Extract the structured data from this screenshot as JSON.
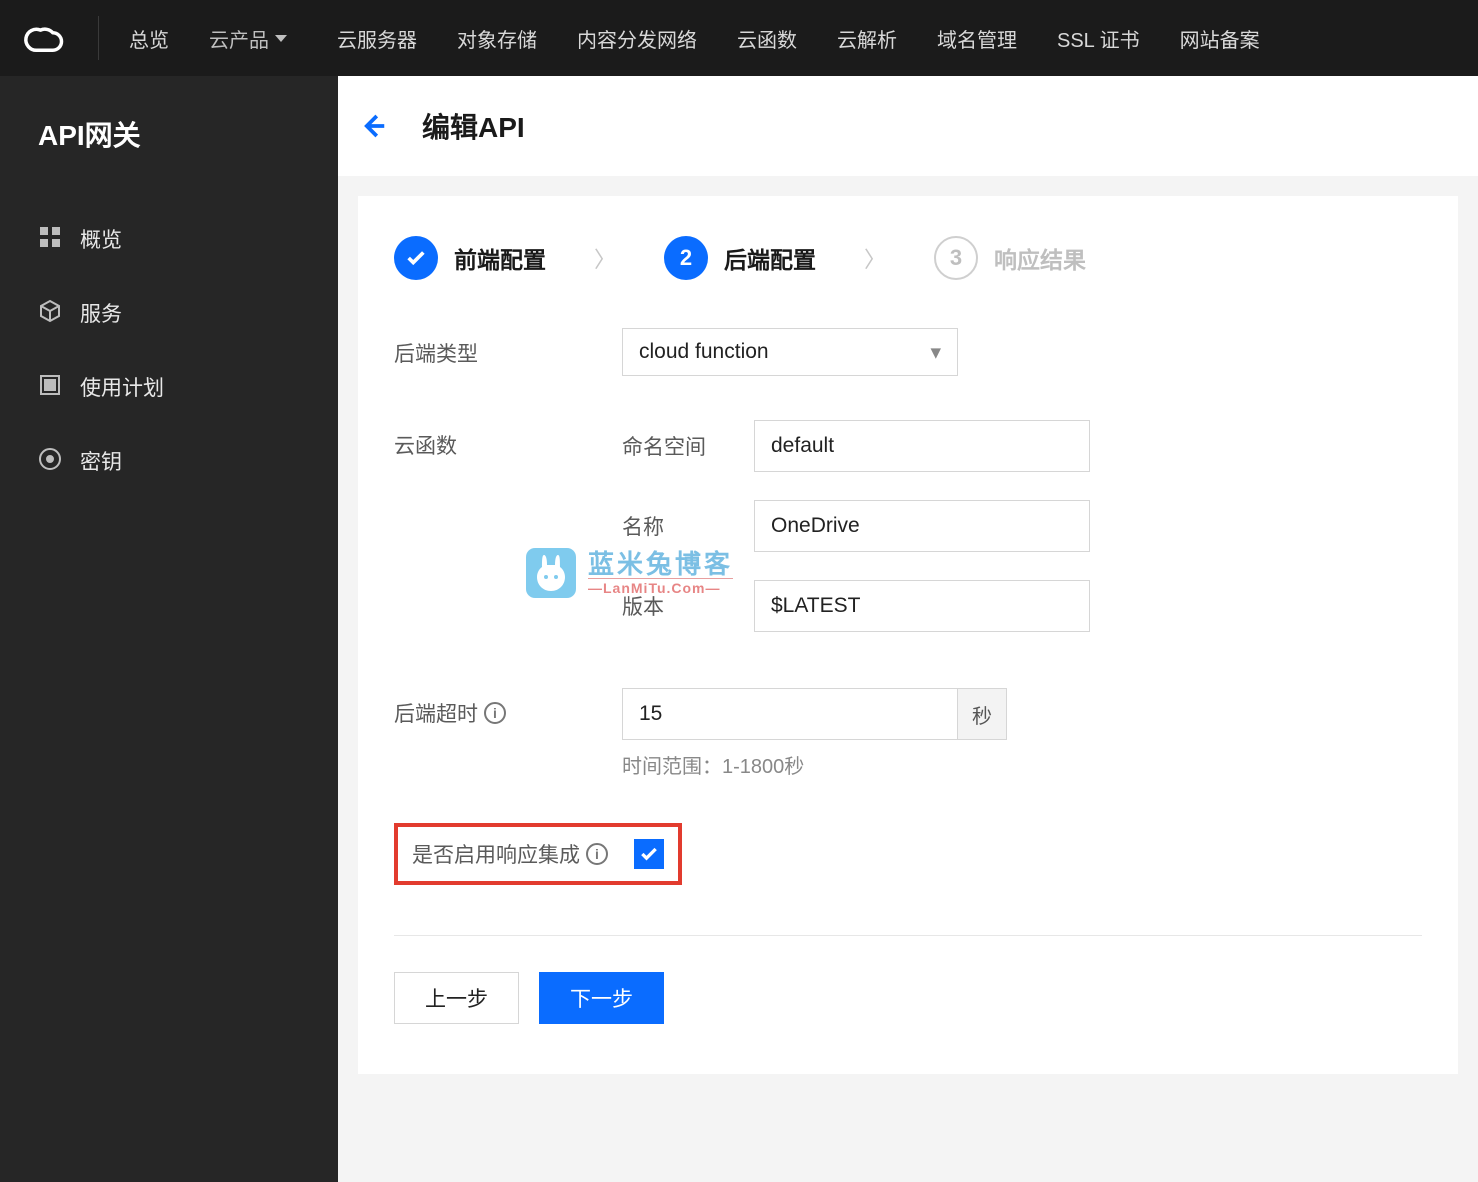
{
  "topnav": {
    "items": [
      "总览",
      "云产品",
      "云服务器",
      "对象存储",
      "内容分发网络",
      "云函数",
      "云解析",
      "域名管理",
      "SSL 证书",
      "网站备案"
    ]
  },
  "sidebar": {
    "title": "API网关",
    "items": [
      {
        "label": "概览"
      },
      {
        "label": "服务"
      },
      {
        "label": "使用计划"
      },
      {
        "label": "密钥"
      }
    ]
  },
  "header": {
    "title": "编辑API"
  },
  "steps": {
    "s1": "前端配置",
    "s2_num": "2",
    "s2": "后端配置",
    "s3_num": "3",
    "s3": "响应结果"
  },
  "form": {
    "backend_type_label": "后端类型",
    "backend_type_value": "cloud function",
    "cloud_func_label": "云函数",
    "namespace_label": "命名空间",
    "namespace_value": "default",
    "name_label": "名称",
    "name_value": "OneDrive",
    "version_label": "版本",
    "version_value": "$LATEST",
    "timeout_label": "后端超时",
    "timeout_value": "15",
    "timeout_unit": "秒",
    "timeout_hint": "时间范围：1-1800秒",
    "resp_int_label": "是否启用响应集成"
  },
  "buttons": {
    "prev": "上一步",
    "next": "下一步"
  },
  "watermark": {
    "cn": "蓝米兔博客",
    "en": "—LanMiTu.Com—"
  }
}
